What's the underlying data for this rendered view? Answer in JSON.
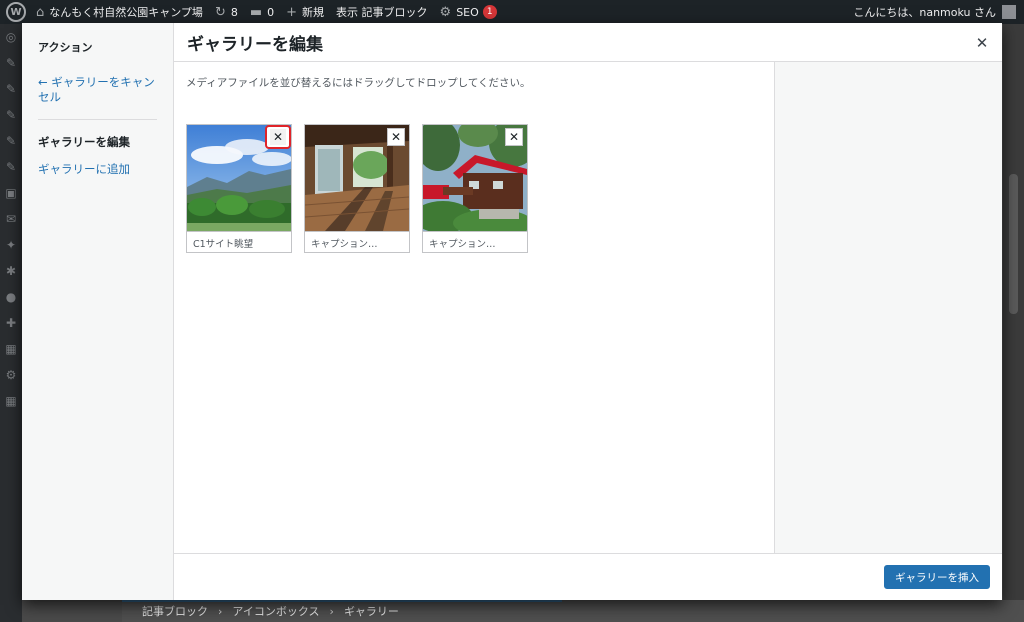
{
  "admin_bar": {
    "site_name": "なんもく村自然公園キャンプ場",
    "updates_count": "8",
    "comments_count": "0",
    "new_label": "新規",
    "view_label": "表示 記事ブロック",
    "seo_label": "SEO",
    "seo_badge": "1",
    "greeting": "こんにちは、nanmoku さん"
  },
  "breadcrumb": {
    "items": [
      "記事ブロック",
      "アイコンボックス",
      "ギャラリー"
    ]
  },
  "modal": {
    "menu": {
      "heading": "アクション",
      "cancel_link": "← ギャラリーをキャンセル",
      "active_item": "ギャラリーを編集",
      "add_item": "ギャラリーに追加"
    },
    "title": "ギャラリーを編集",
    "instructions": "メディアファイルを並び替えるにはドラッグしてドロップしてください。",
    "attachments": [
      {
        "caption": "C1サイト眺望",
        "image": "mountain-view"
      },
      {
        "caption": "キャプション…",
        "image": "wooden-deck"
      },
      {
        "caption": "キャプション…",
        "image": "red-roof-cabin"
      }
    ],
    "insert_button": "ギャラリーを挿入"
  },
  "colors": {
    "primary": "#2271b1",
    "highlight": "#e0242a",
    "admin_bar": "#1d2327"
  }
}
